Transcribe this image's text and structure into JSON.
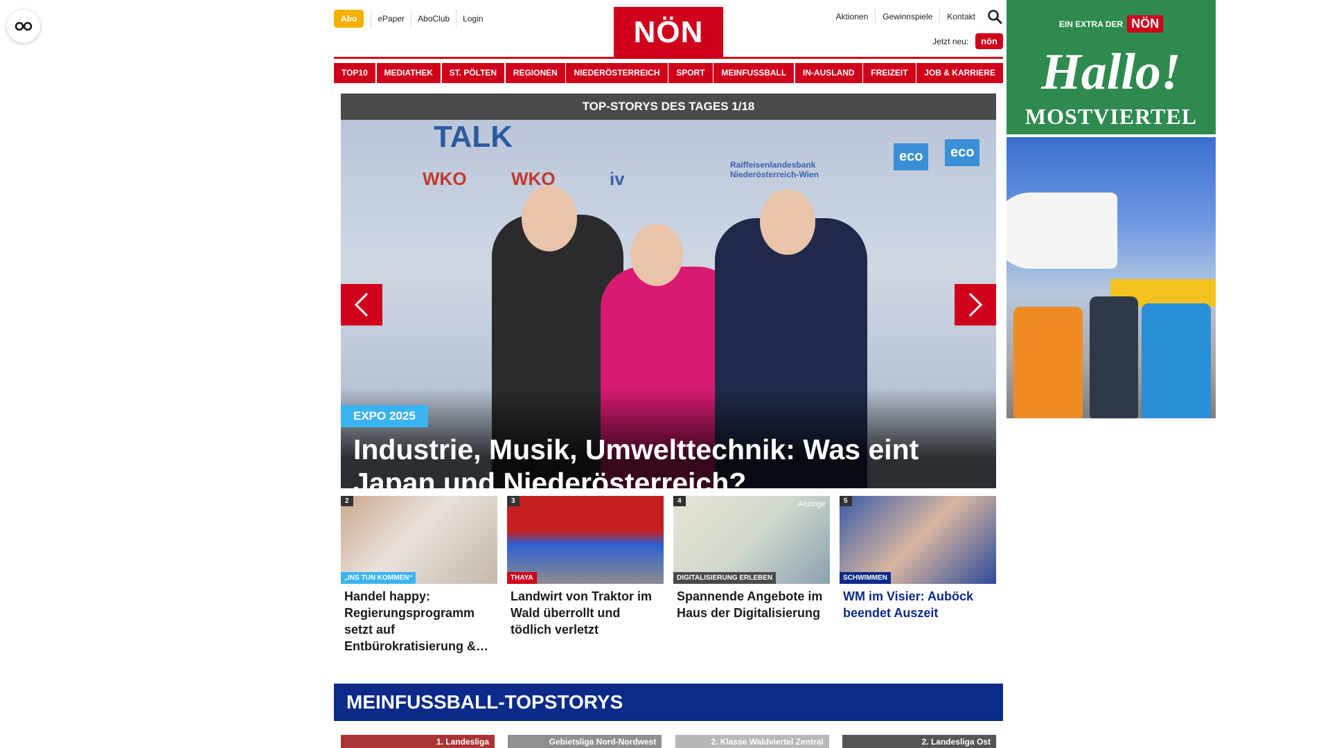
{
  "header": {
    "abo_label": "Abo",
    "links_left": [
      "ePaper",
      "AboClub",
      "Login"
    ],
    "logo_text": "NÖN",
    "links_right": [
      "Aktionen",
      "Gewinnspiele",
      "Kontakt"
    ],
    "jetzt_label": "Jetzt neu:",
    "jetzt_badge": "nön"
  },
  "nav": {
    "items": [
      "TOP10",
      "MEDIATHEK",
      "ST. PÖLTEN",
      "REGIONEN",
      "NIEDERÖSTERREICH",
      "SPORT",
      "MEINFUSSBALL",
      "IN-AUSLAND",
      "FREIZEIT",
      "JOB & KARRIERE"
    ]
  },
  "slider": {
    "header": "TOP-STORYS DES TAGES 1/18",
    "backdrop_text": "TALK",
    "sponsors": [
      "WKO",
      "WKO",
      "iv",
      "Raiffeisenlandesbank Niederösterreich-Wien",
      "eco",
      "eco"
    ],
    "topic": "EXPO 2025",
    "headline": "Industrie, Musik, Umwelttechnik: Was eint Japan und Niederösterreich?"
  },
  "teasers": [
    {
      "num": "2",
      "category": "„INS TUN KOMMEN“",
      "title": "Handel happy: Regierungsprogramm setzt auf Entbürokratisierung &…",
      "cat_color": "#3ab4f0"
    },
    {
      "num": "3",
      "category": "THAYA",
      "title": "Landwirt von Traktor im Wald überrollt und tödlich verletzt",
      "cat_color": "#d0021b"
    },
    {
      "num": "4",
      "category": "DIGITALISIERUNG ERLEBEN",
      "title": "Spannende Angebote im Haus der Digitalisierung",
      "cat_color": "#4a4a4a",
      "badge": "Anzeige"
    },
    {
      "num": "5",
      "category": "SCHWIMMEN",
      "title": "WM im Visier: Auböck beendet Auszeit",
      "cat_color": "#0b2a8a"
    }
  ],
  "meinfussball": {
    "title": "MEINFUSSBALL-TOPSTORYS",
    "cards": [
      "1. Landesliga",
      "Gebietsliga Nord-Nordwest",
      "2. Klasse Waldviertel Zentral",
      "2. Landesliga Ost"
    ]
  },
  "ad": {
    "extra_label": "EIN EXTRA DER",
    "extra_brand": "NÖN",
    "hallo": "Hallo!",
    "region": "MOSTVIERTEL"
  },
  "colors": {
    "brand_red": "#d0021b",
    "abo_yellow": "#f5b000",
    "fussball_blue": "#0b2a8a",
    "tag_cyan": "#3ab4f0",
    "ad_green": "#2f8a4f"
  }
}
